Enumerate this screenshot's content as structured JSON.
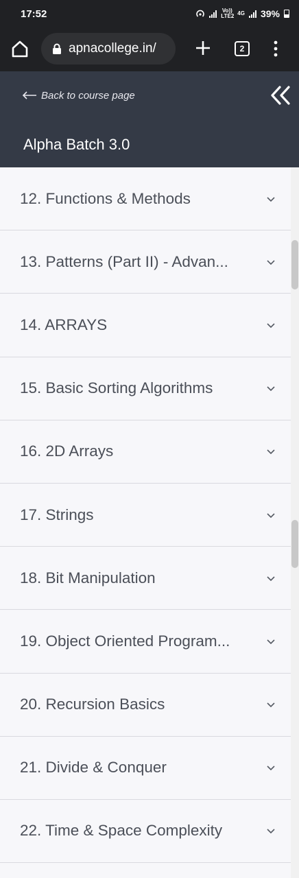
{
  "status_bar": {
    "time": "17:52",
    "network_label_top": "Vo)) LTE2",
    "network_4g": "4G",
    "battery_percent": "39%"
  },
  "browser": {
    "url": "apnacollege.in/",
    "tab_count": "2",
    "icons": [
      "home-icon",
      "lock-icon",
      "plus-icon",
      "tab-switcher-icon",
      "more-vert-icon"
    ]
  },
  "header": {
    "back_label": "Back to course page",
    "batch_title": "Alpha Batch 3.0",
    "icons": [
      "arrow-left-icon",
      "double-chevron-left-icon"
    ],
    "background_color": "#343a46"
  },
  "modules": [
    {
      "label": "12. Functions & Methods"
    },
    {
      "label": "13. Patterns (Part II) - Advan..."
    },
    {
      "label": "14. ARRAYS"
    },
    {
      "label": "15. Basic Sorting Algorithms"
    },
    {
      "label": "16. 2D Arrays"
    },
    {
      "label": "17. Strings"
    },
    {
      "label": "18. Bit Manipulation"
    },
    {
      "label": "19. Object Oriented Program..."
    },
    {
      "label": "20. Recursion Basics"
    },
    {
      "label": "21. Divide & Conquer"
    },
    {
      "label": "22. Time & Space Complexity"
    }
  ]
}
